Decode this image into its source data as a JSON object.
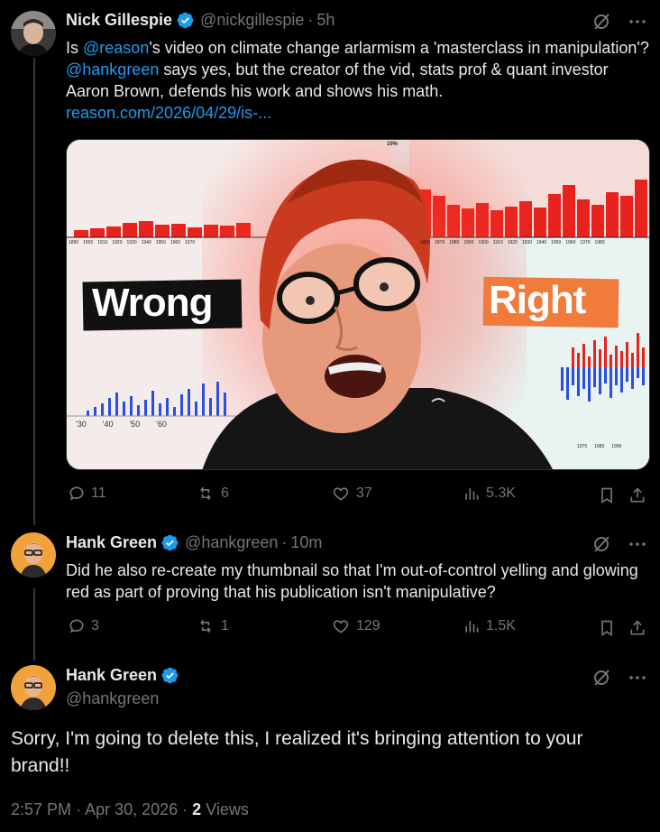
{
  "tweet1": {
    "name": "Nick Gillespie",
    "handle": "@nickgillespie",
    "time": "5h",
    "text_parts": {
      "p1": "Is ",
      "m1": "@reason",
      "p2": "'s video on climate change arlarmism a 'masterclass in manipulation'? ",
      "m2": "@hankgreen",
      "p3": " says yes, but the creator of the vid, stats prof & quant investor Aaron Brown, defends his work and shows his math.",
      "link": "reason.com/2026/04/29/is-..."
    },
    "thumbnail": {
      "left_label": "Wrong",
      "right_label": "Right",
      "left_years": [
        "1890",
        "1900",
        "1910",
        "1920",
        "1930",
        "1940",
        "1950",
        "1960",
        "1970"
      ],
      "right_years": [
        "1860",
        "1870",
        "1880",
        "1890",
        "1900",
        "1910",
        "1920",
        "1930",
        "1940",
        "1950",
        "1960",
        "1970",
        "1980"
      ],
      "left_bottom_ticks": [
        "'30",
        "'40",
        "'50",
        "'60"
      ],
      "right_bottom_ticks": [
        "1975",
        "1985",
        "1995"
      ],
      "top_pct": "10%"
    },
    "stats": {
      "replies": "11",
      "reposts": "6",
      "likes": "37",
      "views": "5.3K"
    }
  },
  "tweet2": {
    "name": "Hank Green",
    "handle": "@hankgreen",
    "time": "10m",
    "text": "Did he also re-create my thumbnail so that I'm out-of-control yelling and glowing red as part of proving that his publication isn't manipulative?",
    "stats": {
      "replies": "3",
      "reposts": "1",
      "likes": "129",
      "views": "1.5K"
    }
  },
  "tweet3": {
    "name": "Hank Green",
    "handle": "@hankgreen",
    "text": "Sorry, I'm going to delete this, I realized it's bringing attention to your brand!!",
    "time": "2:57 PM",
    "date": "Apr 30, 2026",
    "views_count": "2",
    "views_label": "Views"
  },
  "colors": {
    "accent": "#1d9bf0",
    "muted": "#71767b",
    "text": "#e7e9ea",
    "bar_red": "#e8231d",
    "bar_blue": "#2a4fe0",
    "label_orange": "#f07b3a"
  }
}
